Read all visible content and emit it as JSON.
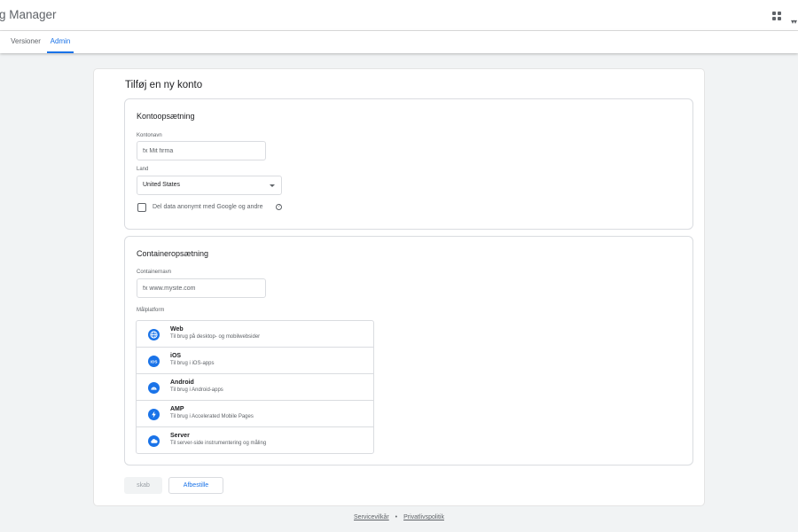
{
  "app": {
    "title": "g Manager"
  },
  "tabs": [
    {
      "label": "Versioner"
    },
    {
      "label": "Admin"
    }
  ],
  "page": {
    "title": "Tilføj en ny konto"
  },
  "account_setup": {
    "title": "Kontoopsætning",
    "account_name": {
      "label": "Kontonavn",
      "placeholder": "fx Mit firma",
      "value": ""
    },
    "country": {
      "label": "Land",
      "value": "United States"
    },
    "share_data": {
      "label": "Del data anonymt med Google og andre",
      "checked": false
    }
  },
  "container_setup": {
    "title": "Containeropsætning",
    "container_name": {
      "label": "Containernavn",
      "placeholder": "fx www.mysite.com",
      "value": ""
    },
    "target_platform": {
      "label": "Målplatform",
      "options": [
        {
          "name": "Web",
          "desc": "Til brug på desktop- og mobilwebsider",
          "icon": "globe-icon"
        },
        {
          "name": "iOS",
          "desc": "Til brug i iOS-apps",
          "icon": "ios-icon"
        },
        {
          "name": "Android",
          "desc": "Til brug i Android-apps",
          "icon": "android-icon"
        },
        {
          "name": "AMP",
          "desc": "Til brug i Accelerated Mobile Pages",
          "icon": "amp-lightning-icon"
        },
        {
          "name": "Server",
          "desc": "Til server-side instrumentering og måling",
          "icon": "cloud-icon"
        }
      ]
    }
  },
  "buttons": {
    "create": "skab",
    "cancel": "Afbestille"
  },
  "footer": {
    "terms": "Servicevilkår",
    "separator": "•",
    "privacy": "Privatlivspolitik"
  },
  "colors": {
    "accent": "#1a73e8",
    "background": "#f1f3f4",
    "border": "#dadce0"
  }
}
